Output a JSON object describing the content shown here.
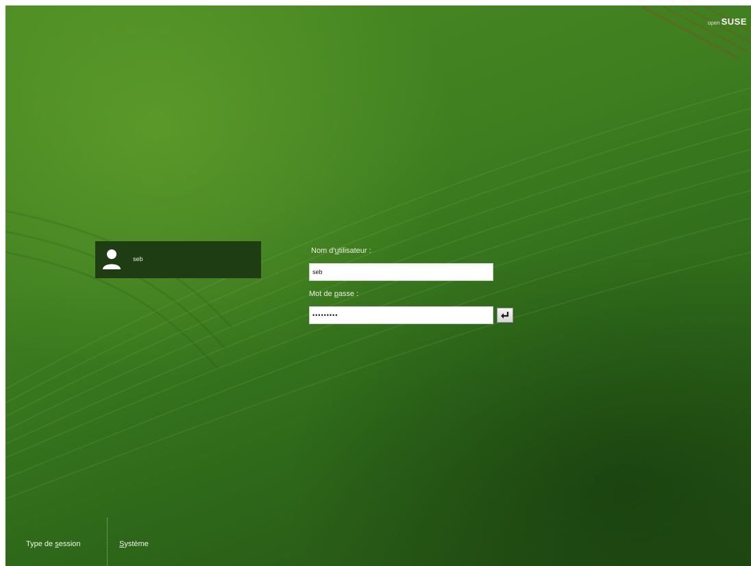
{
  "branding": {
    "logo_prefix": "open",
    "logo_name": "SUSE"
  },
  "user_list": [
    {
      "name": "seb",
      "icon": "user-avatar-icon"
    }
  ],
  "login": {
    "username_label_pre": "Nom d'",
    "username_label_mnemonic": "u",
    "username_label_post": "tilisateur :",
    "username_value": "seb",
    "password_label_pre": "Mot de ",
    "password_label_mnemonic": "p",
    "password_label_post": "asse :",
    "password_value": "sebsebseb",
    "submit_icon": "enter-arrow-icon"
  },
  "bottom_menu": {
    "session_pre": "Type de ",
    "session_mnemonic": "s",
    "session_post": "ession",
    "system_mnemonic": "S",
    "system_post": "ystème"
  },
  "colors": {
    "background_green": "#3f7f20",
    "user_tile": "#1f3d12",
    "text": "#e9f2df"
  }
}
